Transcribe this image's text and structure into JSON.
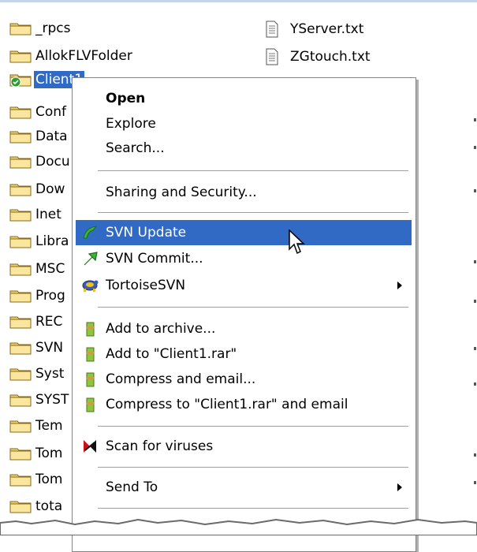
{
  "files_left": [
    {
      "name": "_rpcs"
    },
    {
      "name": "AllokFLVFolder"
    },
    {
      "name": "Client1",
      "selected": true,
      "svn": true
    },
    {
      "name": "Conf"
    },
    {
      "name": "Data"
    },
    {
      "name": "Docu"
    },
    {
      "name": "Dow"
    },
    {
      "name": "Inet"
    },
    {
      "name": "Libra"
    },
    {
      "name": "MSC"
    },
    {
      "name": "Prog"
    },
    {
      "name": "REC"
    },
    {
      "name": "SVN"
    },
    {
      "name": "Syst"
    },
    {
      "name": "SYST"
    },
    {
      "name": "Tem"
    },
    {
      "name": "Tom"
    },
    {
      "name": "Tom"
    },
    {
      "name": "tota"
    }
  ],
  "files_right": [
    {
      "name": "YServer.txt"
    },
    {
      "name": "ZGtouch.txt"
    }
  ],
  "context_menu": {
    "open": "Open",
    "explore": "Explore",
    "search": "Search...",
    "sharing": "Sharing and Security...",
    "svn_update": "SVN Update",
    "svn_commit": "SVN Commit...",
    "tortoise": "TortoiseSVN",
    "add_archive": "Add to archive...",
    "add_rar": "Add to \"Client1.rar\"",
    "compress_email": "Compress and email...",
    "compress_rar_email": "Compress to \"Client1.rar\" and email",
    "scan": "Scan for viruses",
    "send_to": "Send To"
  },
  "colors": {
    "selection": "#316ac5",
    "folder": "#f0d068",
    "menu_border": "#848484"
  },
  "icons": {
    "folder": "folder-icon",
    "text_file": "text-file-icon",
    "svn_update": "svn-update-icon",
    "svn_commit": "svn-commit-icon",
    "tortoise": "tortoise-icon",
    "archive": "winrar-icon",
    "scan": "antivirus-icon"
  }
}
